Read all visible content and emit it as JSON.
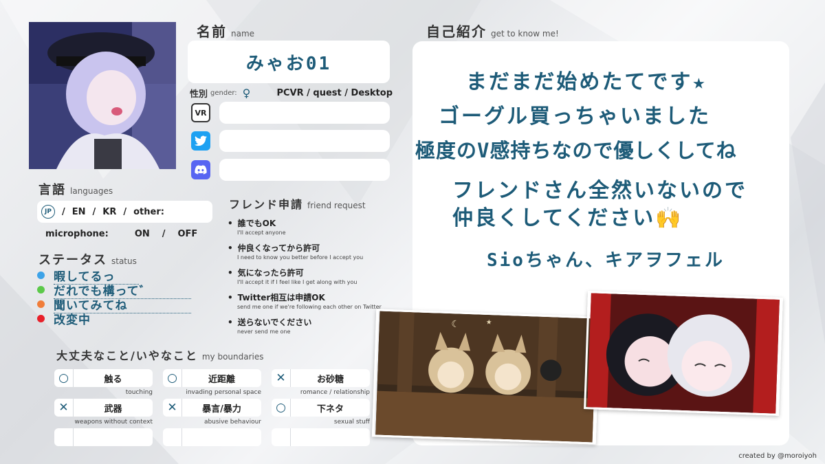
{
  "name_section": {
    "title": "名前",
    "subtitle": "name",
    "value": "みゃお01"
  },
  "gender": {
    "label": "性別",
    "sublabel": "gender:",
    "symbol": "♀",
    "platforms": "PCVR / quest / Desktop"
  },
  "sns": [
    {
      "icon": "vr-icon",
      "label": "VR"
    },
    {
      "icon": "twitter-icon",
      "label": ""
    },
    {
      "icon": "discord-icon",
      "label": ""
    }
  ],
  "languages": {
    "title": "言語",
    "subtitle": "languages",
    "jp": "JP",
    "sep1": "/",
    "en": "EN",
    "sep2": "/",
    "kr": "KR",
    "sep3": "/",
    "other": "other:"
  },
  "microphone": {
    "label": "microphone:",
    "on": "ON",
    "sep": "/",
    "off": "OFF"
  },
  "status": {
    "title": "ステータス",
    "subtitle": "status",
    "items": [
      {
        "text": "暇してるっ",
        "color": "#3da3e8"
      },
      {
        "text": "だれでも構って゛",
        "color": "#5cc94a"
      },
      {
        "text": "聞いてみてね",
        "color": "#f07d3a"
      },
      {
        "text": "改変中",
        "color": "#e8202a"
      }
    ]
  },
  "friend_request": {
    "title": "フレンド申請",
    "subtitle": "friend request",
    "items": [
      {
        "main": "誰でもOK",
        "sub": "I'll accept anyone"
      },
      {
        "main": "仲良くなってから許可",
        "sub": "I need to know you better before I accept you"
      },
      {
        "main": "気になったら許可",
        "sub": "I'll accept it if I feel like I get along with you"
      },
      {
        "main": "Twitter相互は申請OK",
        "sub": "send me one if we're following each other on Twitter"
      },
      {
        "main": "送らないでください",
        "sub": "never send me one"
      }
    ]
  },
  "boundaries": {
    "title": "大丈夫なこと/いやなこと",
    "subtitle": "my boundaries",
    "items": [
      {
        "mark": "○",
        "text": "触る",
        "sub": "touching"
      },
      {
        "mark": "○",
        "text": "近距離",
        "sub": "invading personal space"
      },
      {
        "mark": "✕",
        "text": "お砂糖",
        "sub": "romance / relationship"
      },
      {
        "mark": "✕",
        "text": "武器",
        "sub": "weapons without context"
      },
      {
        "mark": "✕",
        "text": "暴言/暴力",
        "sub": "abusive behaviour"
      },
      {
        "mark": "○",
        "text": "下ネタ",
        "sub": "sexual stuff"
      },
      {
        "mark": "",
        "text": "",
        "sub": ""
      },
      {
        "mark": "",
        "text": "",
        "sub": ""
      },
      {
        "mark": "",
        "text": "",
        "sub": ""
      }
    ]
  },
  "intro": {
    "title": "自己紹介",
    "subtitle": "get to know me!",
    "lines": [
      "まだまだ始めたてです★",
      "ゴーグル買っちゃいました",
      "極度のV感持ちなので優しくしてね",
      "フレンドさん全然いないので",
      "仲良くしてください🙌",
      "Sioちゃん、キアヲフェル"
    ]
  },
  "credit": "created by @moroiyoh",
  "colors": {
    "accent": "#1d5b78",
    "twitter": "#1da1f2",
    "discord": "#5865f2"
  }
}
